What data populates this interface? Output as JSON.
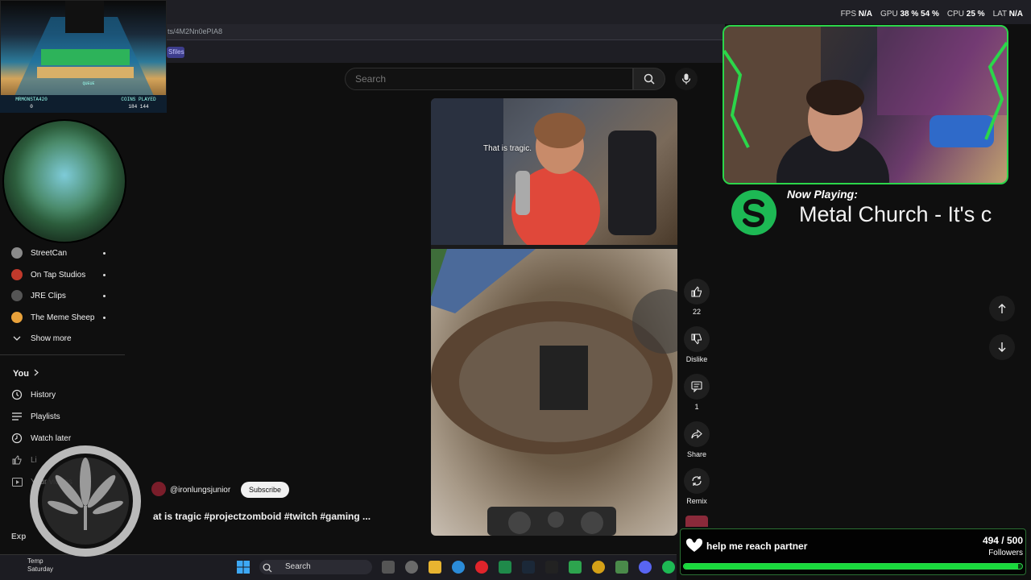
{
  "browser": {
    "url": "ts/4M2Nn0ePIA8",
    "bookmark_chip": "Sfiles"
  },
  "perf": {
    "fps_label": "FPS",
    "fps_value": "N/A",
    "gpu_label": "GPU",
    "gpu_value": "38 % 54 %",
    "cpu_label": "CPU",
    "cpu_value": "25 %",
    "lat_label": "LAT",
    "lat_value": "N/A"
  },
  "search": {
    "placeholder": "Search"
  },
  "game_overlay": {
    "player": "MRMONSTA420",
    "player_value": "0",
    "queue": "QUEUE",
    "coins_label": "COINS PLAYED",
    "coins_value": "184 144"
  },
  "sidebar": {
    "subscriptions": [
      {
        "label": "StreetCan",
        "color": "#8a8a8a"
      },
      {
        "label": "On Tap Studios",
        "color": "#c0392b"
      },
      {
        "label": "JRE Clips",
        "color": "#555555"
      },
      {
        "label": "The Meme Sheep",
        "color": "#e9a23b"
      }
    ],
    "show_more": "Show more",
    "you_label": "You",
    "you_items": [
      {
        "label": "History",
        "icon": "history-icon"
      },
      {
        "label": "Playlists",
        "icon": "playlists-icon"
      },
      {
        "label": "Watch later",
        "icon": "watch-later-icon"
      }
    ],
    "partial_1": "Li",
    "partial_2": "Your videos",
    "partial_3": "Exp"
  },
  "video": {
    "caption": "That is tragic.",
    "channel": "@ironlungsjunior",
    "subscribe": "Subscribe",
    "title": "at is tragic #projectzomboid #twitch #gaming ..."
  },
  "actions": {
    "like_count": "22",
    "dislike_label": "Dislike",
    "comments_count": "1",
    "share_label": "Share",
    "remix_label": "Remix"
  },
  "now_playing": {
    "label": "Now Playing:",
    "track": "Metal Church - It's c"
  },
  "goal": {
    "label": "help me reach partner",
    "count": "494 / 500",
    "unit": "Followers",
    "progress": 0.988
  },
  "taskbar": {
    "search": "Search",
    "weather_line1": "Temp",
    "weather_line2": "Saturday"
  },
  "colors": {
    "accent_green": "#2bd64a",
    "spotify_green": "#1db954",
    "bg": "#0f0f0f"
  }
}
